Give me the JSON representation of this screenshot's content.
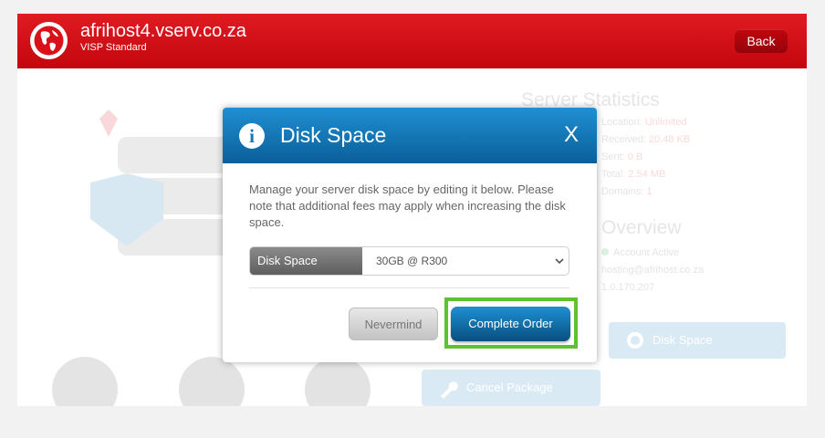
{
  "header": {
    "title": "afrihost4.vserv.co.za",
    "subtitle": "VISP Standard",
    "back_label": "Back"
  },
  "background": {
    "stats_title": "Server Statistics",
    "stats": [
      {
        "label": "Location:",
        "value": "Unlimited"
      },
      {
        "label": "Received:",
        "value": "20.48 KB"
      },
      {
        "label": "Sent:",
        "value": "0 B"
      },
      {
        "label": "Total:",
        "value": "2.54 MB"
      },
      {
        "label": "Domains:",
        "value": "1"
      }
    ],
    "overview_title": "Overview",
    "account_status": "Account Active",
    "account_email": "hosting@afrihost.co.za",
    "account_ip": "1.0.170.207",
    "disk_space_tile": "Disk Space",
    "cancel_tile": "Cancel Package"
  },
  "modal": {
    "title": "Disk Space",
    "close_label": "X",
    "description": "Manage your server disk space by editing it below. Please note that additional fees may apply when increasing the disk space.",
    "field_label": "Disk Space",
    "field_value": "30GB @ R300",
    "nevermind_label": "Nevermind",
    "complete_label": "Complete Order"
  },
  "colors": {
    "header_red": "#d9121a",
    "modal_blue": "#1378b9",
    "highlight_green": "#5dc22e"
  }
}
